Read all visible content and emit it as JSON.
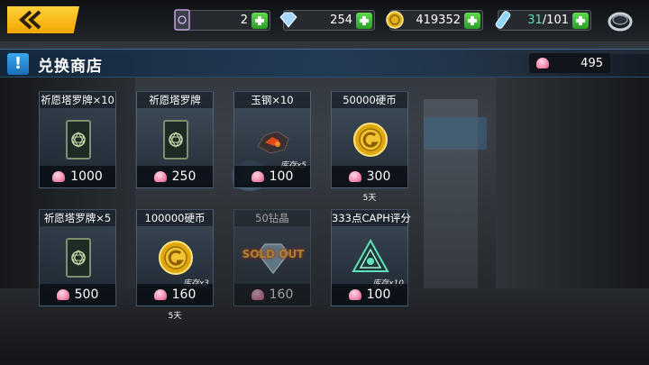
{
  "resources": [
    {
      "name": "tarot-card",
      "value": "2"
    },
    {
      "name": "diamond",
      "value": "254"
    },
    {
      "name": "coin",
      "value": "419352"
    },
    {
      "name": "stamina",
      "current": "31",
      "separator": "/",
      "max": "101"
    }
  ],
  "header": {
    "title": "兑换商店",
    "bang": "!",
    "currency_value": "495"
  },
  "items": [
    {
      "name": "祈愿塔罗牌×10",
      "price": "1000",
      "icon": "tarot-card-icon"
    },
    {
      "name": "祈愿塔罗牌",
      "price": "250",
      "icon": "tarot-card-icon"
    },
    {
      "name": "玉钢×10",
      "price": "100",
      "stock": "库存x5",
      "icon": "steel-ore-icon"
    },
    {
      "name": "50000硬币",
      "price": "300",
      "days": "5天",
      "icon": "gold-coin-icon"
    },
    {
      "name": "祈愿塔罗牌×5",
      "price": "500",
      "icon": "tarot-card-icon"
    },
    {
      "name": "100000硬币",
      "price": "160",
      "stock": "库存x3",
      "days": "5天",
      "icon": "gold-coin-icon"
    },
    {
      "name": "50钻晶",
      "price": "160",
      "sold_label": "SOLD OUT",
      "icon": "diamond-icon"
    },
    {
      "name": "333点CAPH评分",
      "price": "100",
      "stock": "库存x10",
      "icon": "caph-emblem-icon"
    }
  ],
  "colors": {
    "accent": "#f2a600",
    "plus": "#2aa027",
    "stamina": "#5be0b0",
    "header": "#1e3c5a"
  }
}
